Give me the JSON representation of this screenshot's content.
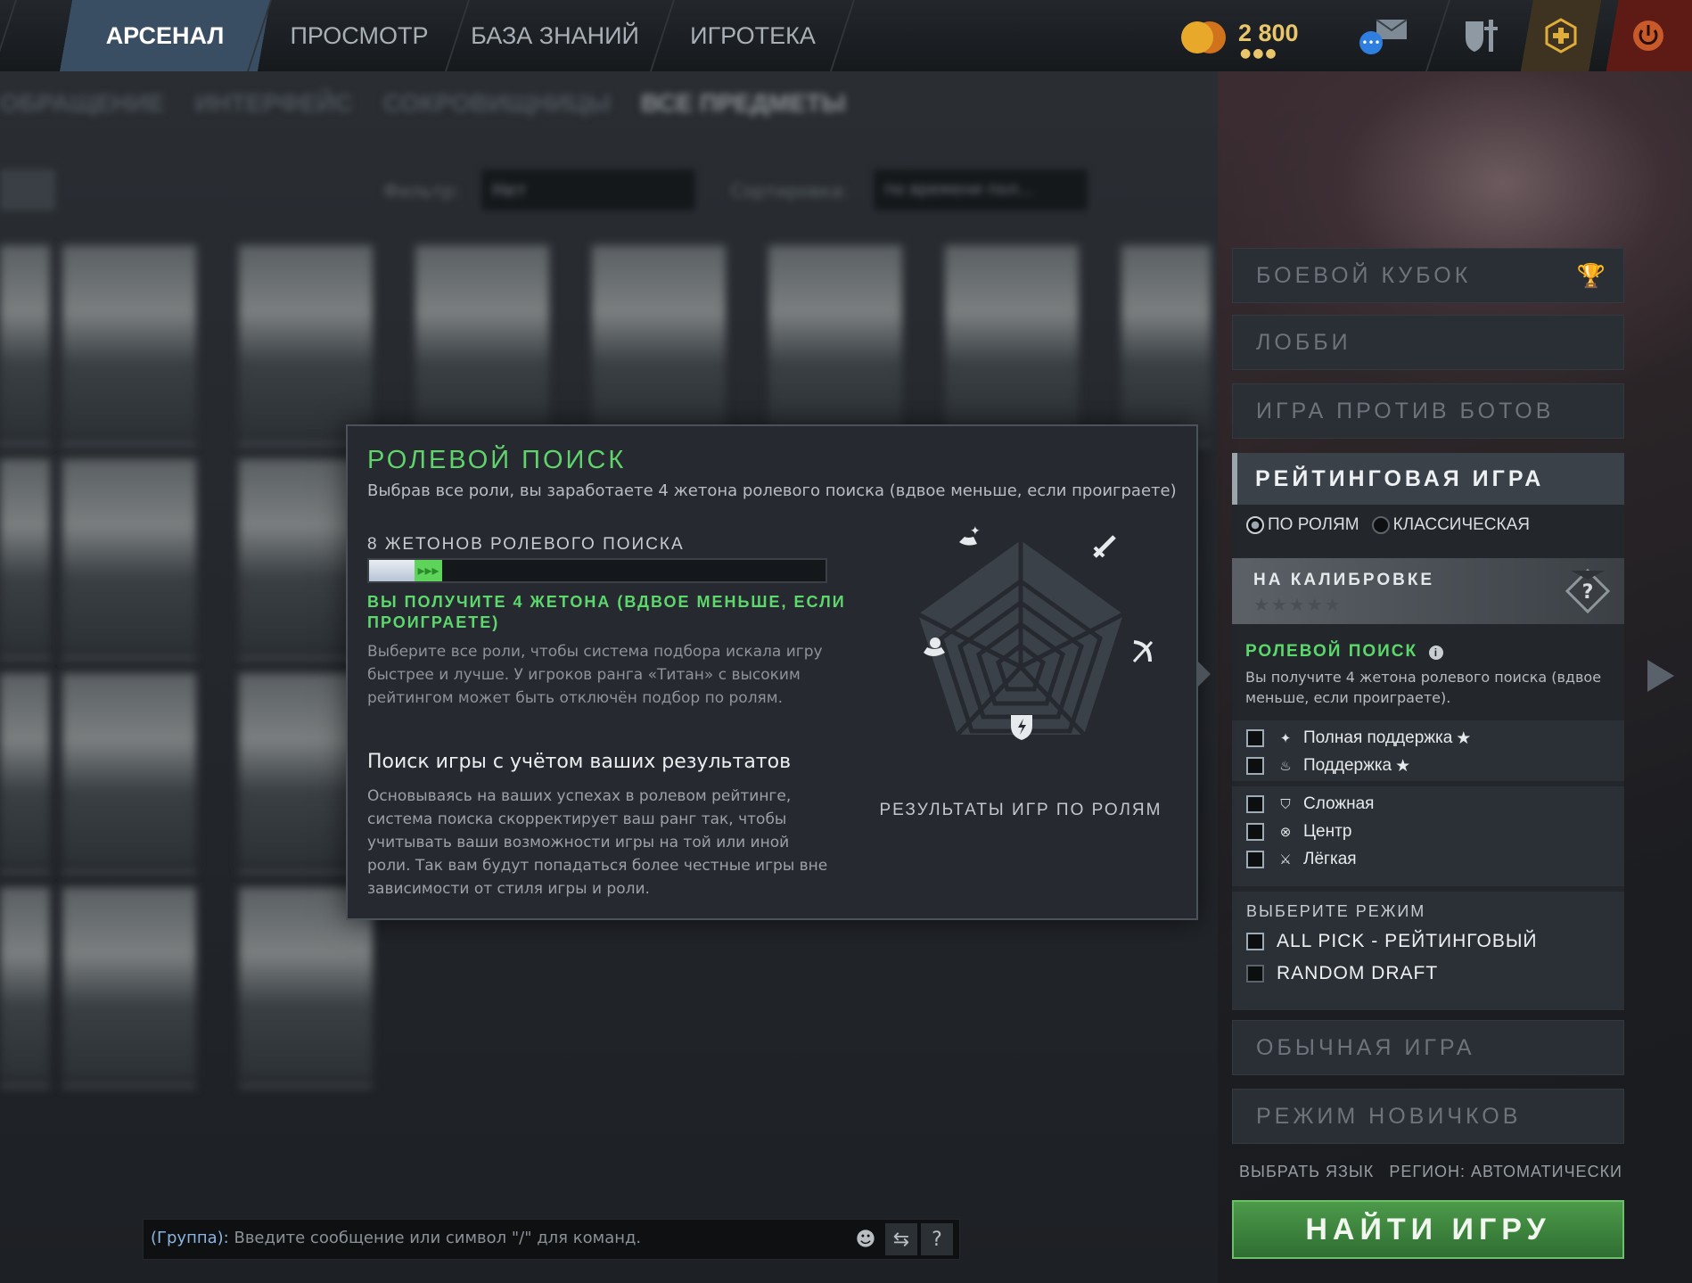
{
  "nav": {
    "tabs": [
      {
        "label": "АРСЕНАЛ",
        "active": true
      },
      {
        "label": "ПРОСМОТР"
      },
      {
        "label": "БАЗА ЗНАНИЙ"
      },
      {
        "label": "ИГРОТЕКА"
      }
    ],
    "currency": {
      "amount": "2 800",
      "icon": "shards-coin-icon"
    },
    "icons": [
      "mail-chat-icon",
      "shield-sword-icon",
      "plus-shop-icon",
      "power-icon"
    ]
  },
  "arsenal": {
    "breadcrumbs": [
      "ОБРАЩЕНИЕ",
      "ИНТЕРФЕЙС",
      "СОКРОВИЩНИЦЫ",
      "ВСЕ ПРЕДМЕТЫ"
    ],
    "filter_label": "Фильтр:",
    "filter_value": "Нет",
    "sort_label": "Сортировка:",
    "sort_value": "по времени пол..."
  },
  "tooltip": {
    "title": "РОЛЕВОЙ ПОИСК",
    "subtitle": "Выбрав все роли, вы заработаете 4 жетона ролевого поиска (вдвое меньше, если проиграете)",
    "tokens_label": "8 ЖЕТОНОВ РОЛЕВОГО ПОИСКА",
    "tokens_current": 8,
    "tokens_gain": 4,
    "tokens_bar_fraction": 0.1,
    "tokens_gain_fraction": 0.06,
    "gain_text": "ВЫ ПОЛУЧИТЕ 4 ЖЕТОНА (ВДВОЕ МЕНЬШЕ, ЕСЛИ ПРОИГРАЕТЕ)",
    "hint": "Выберите все роли, чтобы система подбора искала игру быстрее и лучше. У игроков ранга «Титан» с высоким рейтингом может быть отключён подбор по ролям.",
    "heading": "Поиск игры с учётом ваших результатов",
    "body": "Основываясь на ваших успехах в ролевом рейтинге, система поиска скорректирует ваш ранг так, чтобы учитывать ваши возможности игры на той или иной роли. Так вам будут попадаться более честные игры вне зависимости от стиля игры и роли.",
    "radar_label": "РЕЗУЛЬТАТЫ ИГР ПО РОЛЯМ",
    "radar_icons": [
      "hard-support-icon",
      "carry-sword-icon",
      "offlane-icon",
      "mid-bow-icon",
      "support-icon"
    ]
  },
  "play": {
    "modes": {
      "battle_cup": "БОЕВОЙ КУБОК",
      "lobby": "ЛОББИ",
      "bots": "ИГРА ПРОТИВ БОТОВ",
      "ranked": "РЕЙТИНГОВАЯ ИГРА",
      "normal": "ОБЫЧНАЯ ИГРА",
      "newbie": "РЕЖИМ НОВИЧКОВ"
    },
    "ranked": {
      "radio_roles": "ПО РОЛЯМ",
      "radio_classic": "КЛАССИЧЕСКАЯ",
      "calibration": "НА КАЛИБРОВКЕ",
      "calibration_stars": "★★★★★",
      "role_search_title": "РОЛЕВОЙ ПОИСК",
      "role_search_desc": "Вы получите 4 жетона ролевого поиска (вдвое меньше, если проиграете).",
      "roles": [
        {
          "label": "Полная поддержка",
          "star": "★",
          "icon": "hard-support-icon"
        },
        {
          "label": "Поддержка",
          "star": "★",
          "icon": "support-icon"
        },
        {
          "label": "Сложная",
          "icon": "offlane-icon"
        },
        {
          "label": "Центр",
          "icon": "mid-icon"
        },
        {
          "label": "Лёгкая",
          "icon": "carry-icon"
        }
      ],
      "select_mode_title": "ВЫБЕРИТЕ РЕЖИМ",
      "mode_options": [
        "ALL PICK - РЕЙТИНГОВЫЙ",
        "RANDOM DRAFT"
      ]
    },
    "language": "ВЫБРАТЬ ЯЗЫК",
    "region": "РЕГИОН: АВТОМАТИЧЕСКИ",
    "find_button": "НАЙТИ ИГРУ"
  },
  "chat": {
    "group_label": "(Группа):",
    "placeholder": "Введите сообщение или символ \"/\" для команд.",
    "buttons": [
      "emoji-icon",
      "share-icon",
      "help-icon"
    ],
    "help_label": "?"
  },
  "colors": {
    "accent_green": "#5fd46b",
    "find_button": "#3f8a40",
    "gold": "#e9c66a"
  }
}
